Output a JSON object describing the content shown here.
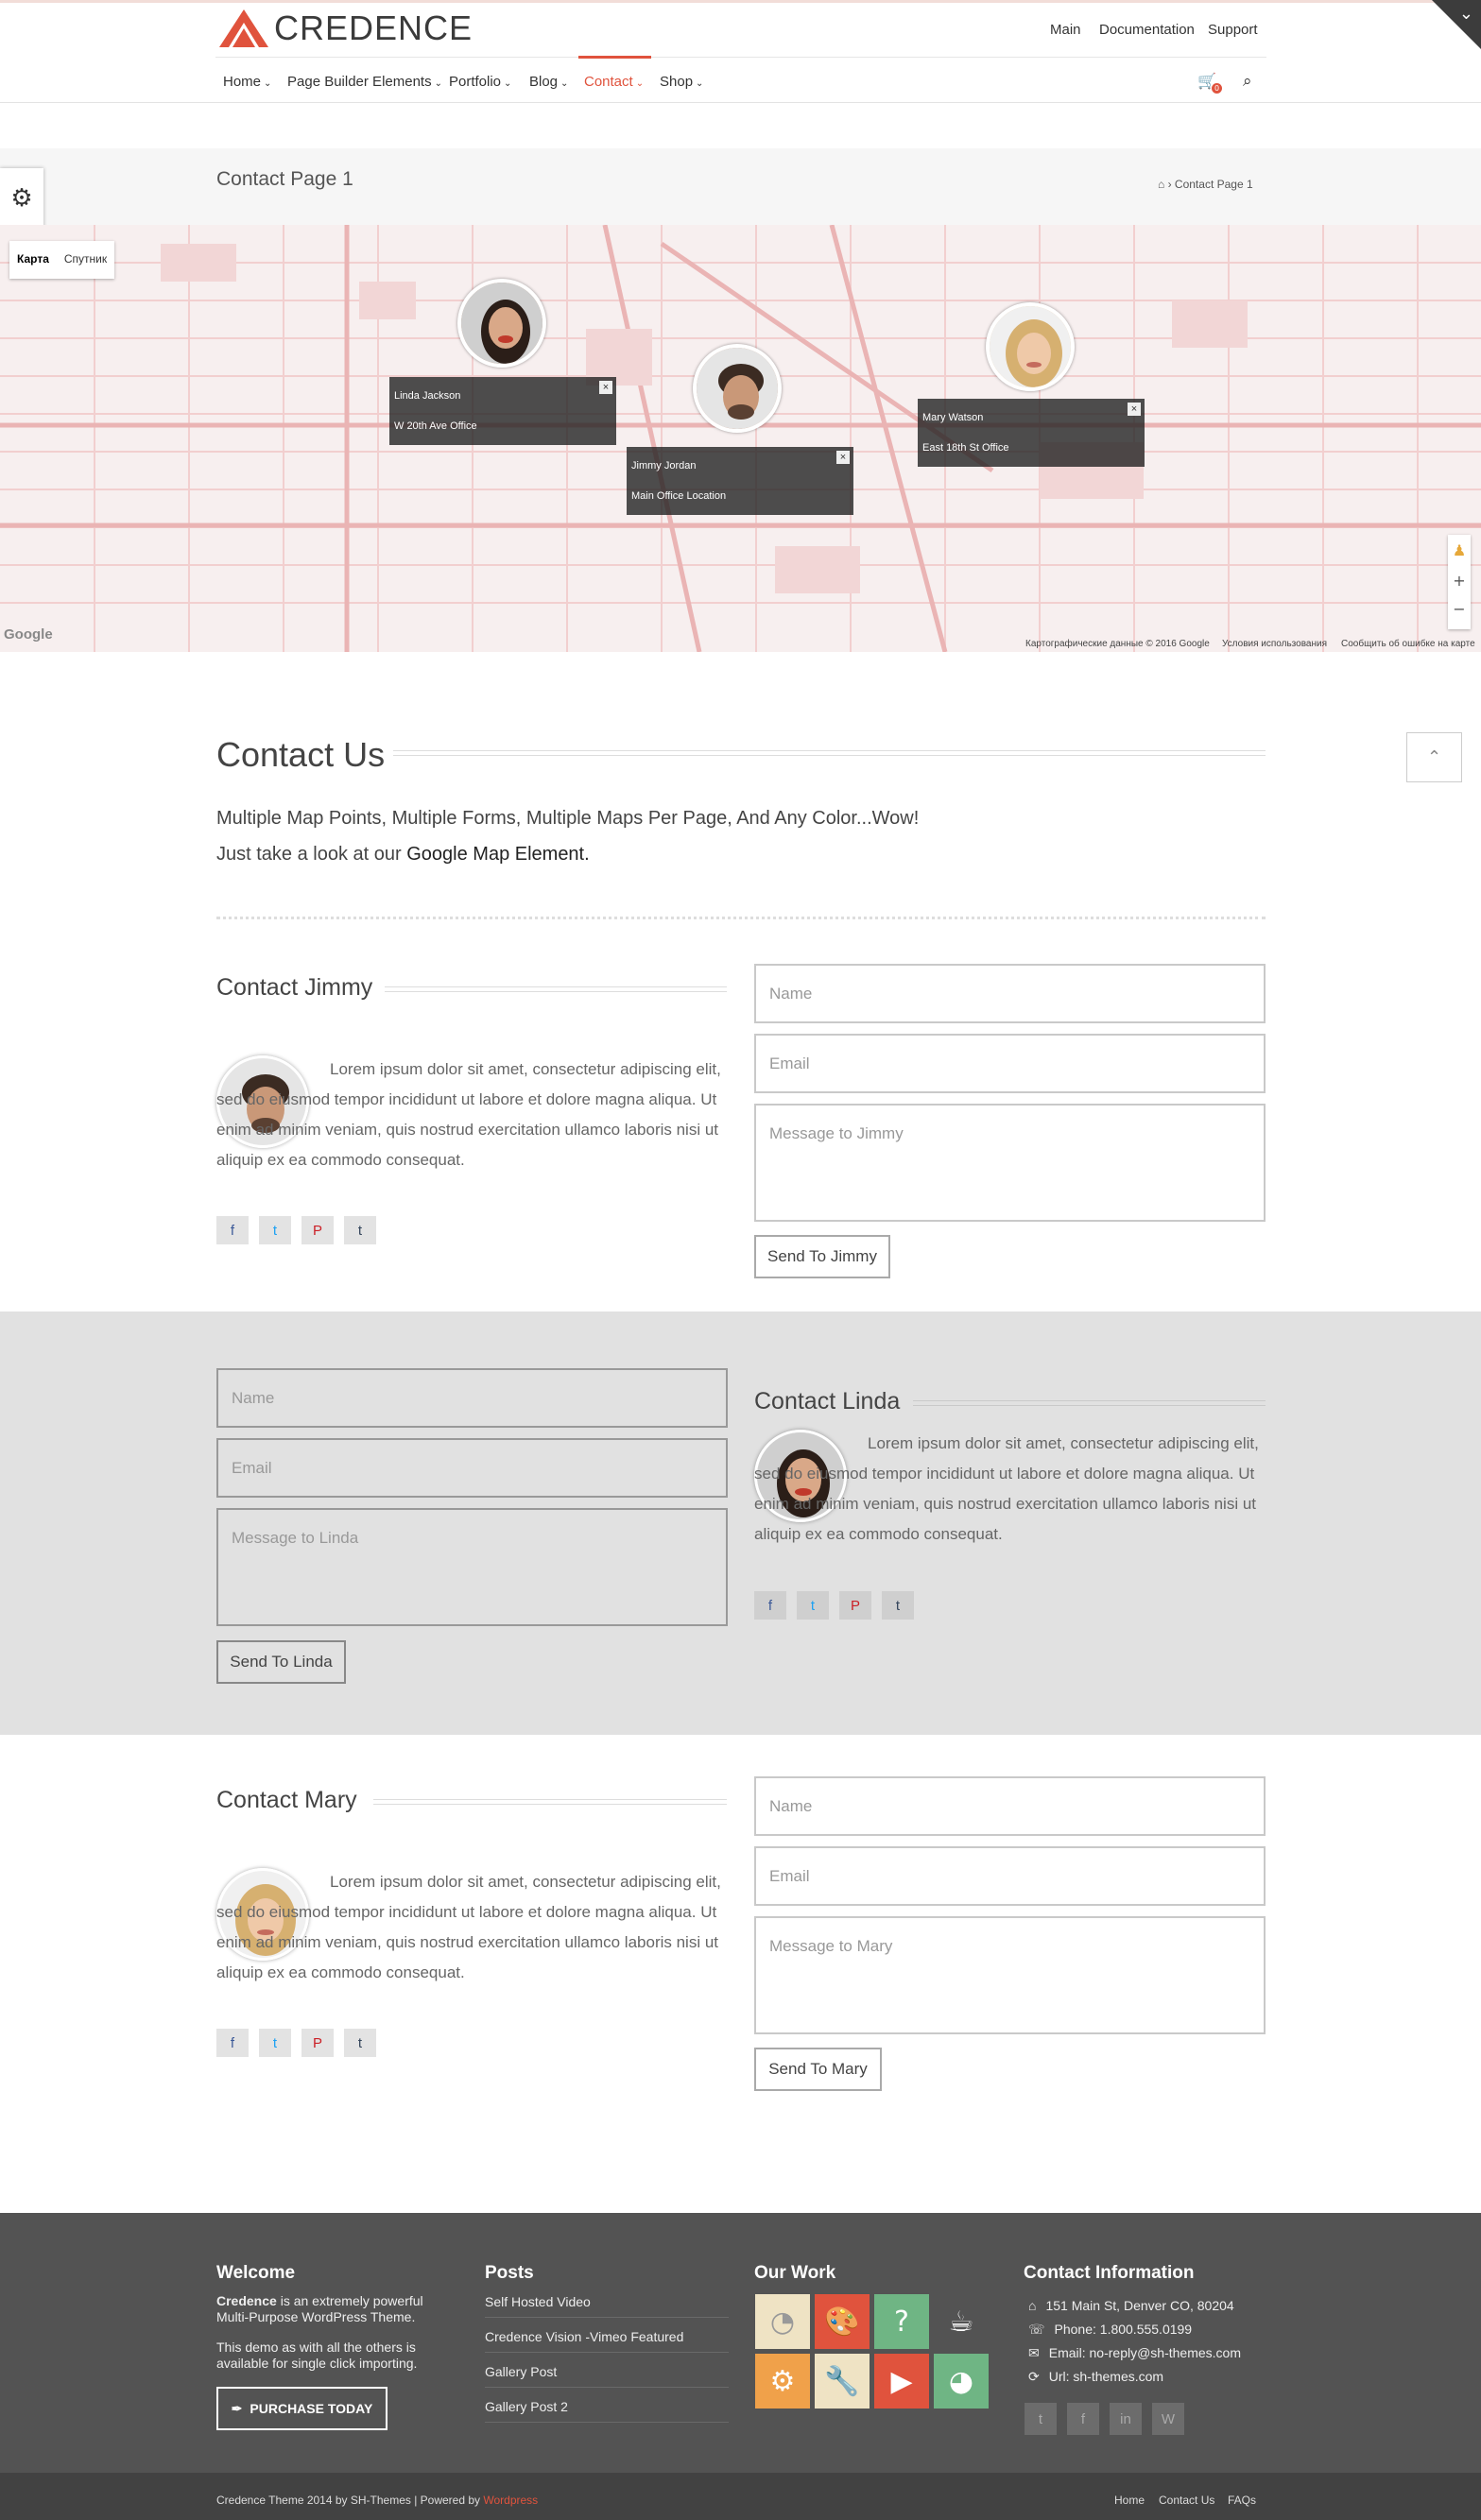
{
  "header": {
    "logo_text": "CREDENCE",
    "top_links": [
      "Main",
      "Documentation",
      "Support"
    ],
    "nav": [
      "Home",
      "Page Builder Elements",
      "Portfolio",
      "Blog",
      "Contact",
      "Shop"
    ],
    "active_nav": "Contact",
    "cart_count": "0",
    "accent_color": "#e0533d"
  },
  "page_header": {
    "title": "Contact Page 1",
    "breadcrumb_current": "Contact Page 1"
  },
  "map": {
    "type_buttons": [
      "Карта",
      "Спутник"
    ],
    "markers": [
      {
        "name": "Linda Jackson",
        "office": "W 20th Ave Office"
      },
      {
        "name": "Jimmy Jordan",
        "office": "Main Office Location"
      },
      {
        "name": "Mary Watson",
        "office": "East 18th St Office"
      }
    ],
    "attribution": [
      "Картографические данные © 2016 Google",
      "Условия использования",
      "Сообщить об ошибке на карте"
    ],
    "google_logo": "Google",
    "zoom_in": "+",
    "zoom_out": "−"
  },
  "intro": {
    "title": "Contact Us",
    "line1": "Multiple Map Points, Multiple Forms,  Multiple Maps Per Page, And Any Color...Wow!",
    "line2_prefix": "Just take a look at our ",
    "line2_link": "Google Map Element."
  },
  "lorem": "Lorem ipsum dolor sit amet, consectetur adipiscing elit, sed do eiusmod tempor incididunt ut labore et dolore magna aliqua. Ut enim ad minim veniam, quis nostrud exercitation ullamco laboris nisi ut aliquip ex ea commodo consequat.",
  "contacts": [
    {
      "title": "Contact Jimmy",
      "name_ph": "Name",
      "email_ph": "Email",
      "msg_ph": "Message to Jimmy",
      "button": "Send To Jimmy"
    },
    {
      "title": "Contact Linda",
      "name_ph": "Name",
      "email_ph": "Email",
      "msg_ph": "Message to Linda",
      "button": "Send To Linda"
    },
    {
      "title": "Contact Mary",
      "name_ph": "Name",
      "email_ph": "Email",
      "msg_ph": "Message to Mary",
      "button": "Send To Mary"
    }
  ],
  "social_icons": [
    "facebook-icon",
    "twitter-icon",
    "pinterest-icon",
    "tumblr-icon"
  ],
  "footer": {
    "welcome_title": "Welcome",
    "welcome_brand": "Credence",
    "welcome_text1": " is an extremely powerful Multi-Purpose WordPress Theme.",
    "welcome_text2": "This demo as with all the others is available for single click importing.",
    "purchase_label": "PURCHASE TODAY",
    "posts_title": "Posts",
    "posts": [
      "Self Hosted Video",
      "Credence Vision -Vimeo Featured",
      "Gallery Post",
      "Gallery Post 2"
    ],
    "work_title": "Our Work",
    "contact_title": "Contact Information",
    "address": "151 Main St, Denver CO, 80204",
    "phone": "Phone: 1.800.555.0199",
    "email": "Email: no-reply@sh-themes.com",
    "url": "Url: sh-themes.com",
    "copyright_prefix": "Credence Theme 2014 by SH-Themes | Powered by ",
    "copyright_link": "Wordpress",
    "bottom_links": [
      "Home",
      "Contact Us",
      "FAQs"
    ]
  }
}
